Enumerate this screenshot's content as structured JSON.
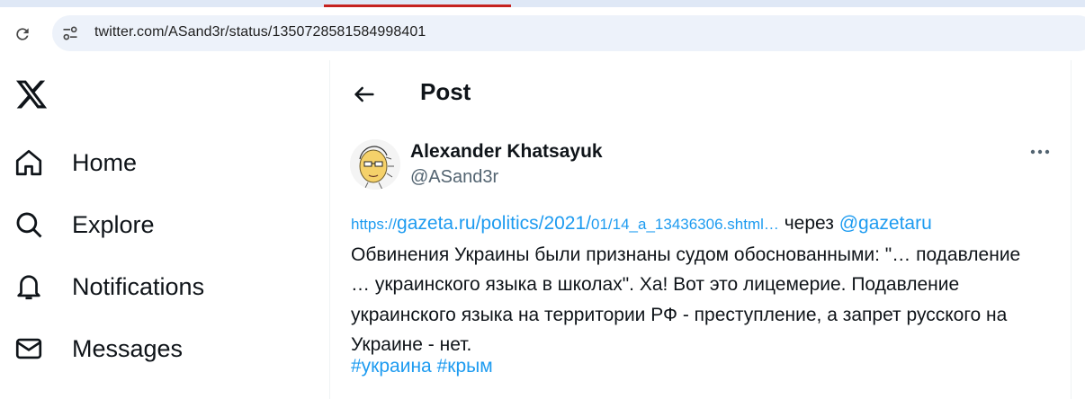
{
  "browser": {
    "url": "twitter.com/ASand3r/status/1350728581584998401",
    "accent_color": "#c5221f"
  },
  "sidebar": {
    "logo": "x-logo",
    "items": [
      {
        "label": "Home",
        "icon": "home-icon"
      },
      {
        "label": "Explore",
        "icon": "search-icon"
      },
      {
        "label": "Notifications",
        "icon": "bell-icon"
      },
      {
        "label": "Messages",
        "icon": "envelope-icon"
      }
    ]
  },
  "header": {
    "title": "Post"
  },
  "tweet": {
    "author_name": "Alexander Khatsayuk",
    "author_handle": "@ASand3r",
    "link_prefix": "https://",
    "link_main": "gazeta.ru/politics/2021/",
    "link_tail": "01/14_a_13436306.shtml…",
    "via_text": " через ",
    "via_handle": "@gazetaru",
    "body": "Обвинения Украины были признаны судом обоснованными: \"… подавление … украинского языка в школах\". Ха! Вот это лицемерие. Подавление украинского языка на территории РФ - преступление, а запрет русского на Украине - нет.",
    "hashtag_1": "#украина",
    "hashtag_2": "#крым",
    "link_color": "#1d9bf0"
  }
}
